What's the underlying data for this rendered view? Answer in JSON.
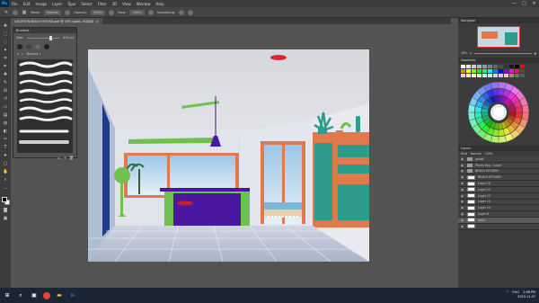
{
  "app": {
    "logo": "Ps"
  },
  "menu": [
    "File",
    "Edit",
    "Image",
    "Layer",
    "Type",
    "Select",
    "Filter",
    "3D",
    "View",
    "Window",
    "Help"
  ],
  "window_controls": [
    "—",
    "□",
    "✕"
  ],
  "options": {
    "mode_label": "Mode:",
    "mode_value": "Normal",
    "opacity_label": "Opacity:",
    "opacity_value": "100%",
    "flow_label": "Flow:",
    "flow_value": "100%",
    "smoothing_label": "Smoothing:"
  },
  "document_tab": {
    "title": "LOCATION BEACH HOUSE.psd @ 16% (walls, RGB/8)",
    "close": "×"
  },
  "brushes_panel": {
    "title": "Brushes",
    "size_label": "Size:",
    "size_value": "600 px",
    "folder_label": "Brushes 1",
    "size_fraction": 0.7
  },
  "navigator_panel": {
    "tabs": [
      "Navigator"
    ],
    "zoom_value": "16%"
  },
  "swatches_panel": {
    "tabs": [
      "Swatches"
    ]
  },
  "layers_panel": {
    "tabs": [
      "Layers"
    ],
    "filter_row": [
      "Kind",
      "Normal",
      "100%"
    ],
    "layers": [
      {
        "type": "folder",
        "name": "jacket"
      },
      {
        "type": "folder",
        "name": "Plants Buy... Layer"
      },
      {
        "type": "folder",
        "name": "BEACH KITCHEN"
      },
      {
        "type": "layer",
        "name": "BEACH KITCHEN"
      },
      {
        "type": "layer",
        "name": "Layer 10"
      },
      {
        "type": "layer",
        "name": "Layer 11"
      },
      {
        "type": "layer",
        "name": "Layer 12"
      },
      {
        "type": "layer",
        "name": "Layer 13"
      },
      {
        "type": "layer",
        "name": "Layer 14"
      },
      {
        "type": "layer",
        "name": "Layer 8"
      },
      {
        "type": "layer",
        "name": "walls"
      },
      {
        "type": "layer",
        "name": ""
      }
    ]
  },
  "taskbar": {
    "apps": [
      "Chrome",
      "Explorer",
      "Photoshop"
    ],
    "tray": [
      "^",
      "ENG"
    ],
    "clock_time": "2:58 PM",
    "clock_date": "2019-11-07"
  },
  "colors": {
    "ps_blue": "#31a8ff",
    "wall_light": "#d9dde5",
    "wall_blue": "#aebdd4",
    "orange": "#e07a4c",
    "teal": "#2e9c8a",
    "green": "#6fc04e",
    "purple": "#4a18a0",
    "red_stool": "#c5202b"
  }
}
